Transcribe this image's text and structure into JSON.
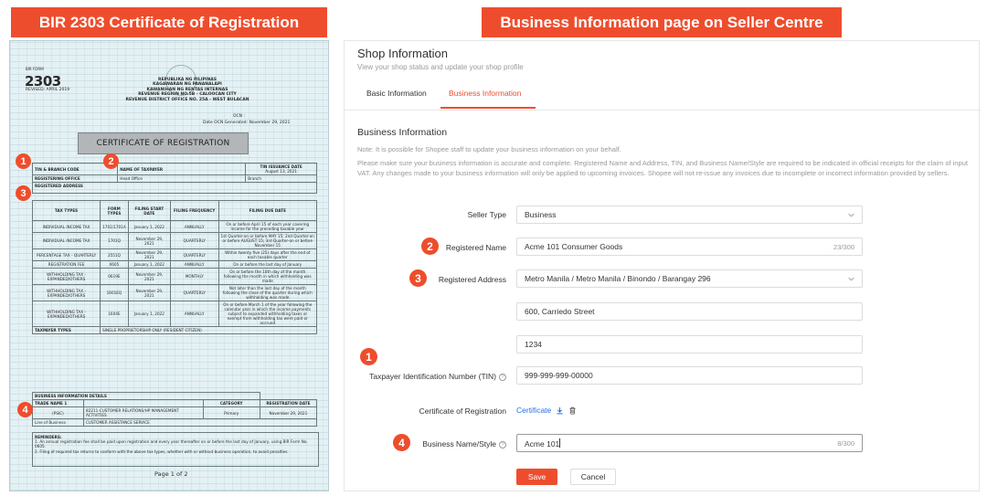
{
  "banners": {
    "left": "BIR 2303 Certificate of Registration",
    "right": "Business Information page on Seller Centre"
  },
  "certificate": {
    "form_label": "BIR FORM",
    "form_number": "2303",
    "revised": "REVISED: APRIL 2019",
    "agency_lines": [
      "REPUBLIKA NG PILIPINAS",
      "KAGAWARAN NG PANANALAPI",
      "KAWANIHAN NG RENTAS INTERNAS",
      "REVENUE REGION NO.5B - CALOOCAN CITY",
      "REVENUE DISTRICT OFFICE NO. 25A - WEST BULACAN"
    ],
    "ocn": "OCN :",
    "ocn_date": "Date OCN Generated: November 29, 2021",
    "title": "CERTIFICATE OF REGISTRATION",
    "header": {
      "tin_branch_code": "TIN & BRANCH CODE",
      "name_of_taxpayer": "NAME OF TAXPAYER",
      "tin_issuance_date": "TIN ISSUANCE DATE",
      "issuance_value": "August 13, 2021",
      "registering_office": "REGISTERING OFFICE",
      "head_office": "Head Office",
      "branch": "Branch",
      "registered_address": "REGISTERED ADDRESS"
    },
    "tax_columns": [
      "TAX TYPES",
      "FORM TYPES",
      "FILING START DATE",
      "FILING FREQUENCY",
      "FILING DUE DATE"
    ],
    "tax_rows": [
      [
        "INDIVIDUAL INCOME TAX",
        "1701/1701A",
        "January 1, 2022",
        "ANNUALLY",
        "On or before April 15 of each year covering income for the preceding taxable year"
      ],
      [
        "INDIVIDUAL INCOME TAX",
        "1701Q",
        "November 29, 2021",
        "QUARTERLY",
        "1st Quarter-on or before MAY 15; 2nd Quarter-on or before AUGUST 15; 3rd Quarter-on or before November 15"
      ],
      [
        "PERCENTAGE TAX - QUARTERLY",
        "2551Q",
        "November 29, 2021",
        "QUARTERLY",
        "Within twenty five (25) days after the end of each taxable quarter"
      ],
      [
        "REGISTRATION FEE",
        "0605",
        "January 1, 2022",
        "ANNUALLY",
        "On or before the last day of January"
      ],
      [
        "WITHHOLDING TAX - EXPANDED/OTHERS",
        "0619E",
        "November 29, 2021",
        "MONTHLY",
        "On or before the 10th day of the month following the month in which withholding was made"
      ],
      [
        "WITHHOLDING TAX - EXPANDED/OTHERS",
        "1601EQ",
        "November 29, 2021",
        "QUARTERLY",
        "Not later than the last day of the month following the close of the quarter during which withholding was made"
      ],
      [
        "WITHHOLDING TAX - EXPANDED/OTHERS",
        "1604E",
        "January 1, 2022",
        "ANNUALLY",
        "On or before March 1 of the year following the calendar year in which the income payments subject to expanded withholding taxes or exempt from withholding tax were paid or accrued"
      ]
    ],
    "taxpayer_types_label": "TAXPAYER TYPES",
    "taxpayer_types_value": "SINGLE PROPRIETORSHIP ONLY (RESIDENT CITIZEN)",
    "business_details_label": "BUSINESS INFORMATION DETAILS",
    "category_label": "CATEGORY",
    "registration_date_label": "REGISTRATION DATE",
    "trade_name_label": "TRADE NAME 1",
    "registration_date_value": "November 29, 2021",
    "psic_label": "(PSIC)",
    "psic_value": "82211-CUSTOMER RELATIONS/HP MANAGEMENT ACTIVITIES",
    "category_value": "Primary",
    "line_of_business_label": "Line of Business",
    "line_of_business_value": "CUSTOMER ASSISTANCE SERVICE",
    "reminders_title": "REMINDERS:",
    "reminders": [
      "1.  An annual registration fee shall be paid upon registration and every year thereafter on or before the last day of January, using BIR Form No. 0605.",
      "2.  Filing of required tax returns to conform with the above tax types, whether with or without business operation, to avoid penalties."
    ],
    "page": "Page 1 of 2",
    "badges": [
      "1",
      "2",
      "3",
      "4"
    ]
  },
  "seller_centre": {
    "title": "Shop Information",
    "subtitle": "View your shop status and update your shop profile",
    "tabs": [
      "Basic Information",
      "Business Information"
    ],
    "section_title": "Business Information",
    "note1": "Note: It is possible for Shopee staff to update your business information on your behalf.",
    "note2": "Please make sure your business information is accurate and complete. Registered Name and Address, TIN, and Business Name/Style are required to be indicated in official receipts for the claim of input VAT. Any changes made to your business information will only be applied to upcoming invoices. Shopee will not re-issue any invoices due to incomplete or incorrect information provided by sellers.",
    "seller_type_label": "Seller Type",
    "seller_type_value": "Business",
    "registered_name_label": "Registered Name",
    "registered_name_value": "Acme 101 Consumer Goods",
    "registered_name_count": "23/300",
    "registered_address_label": "Registered Address",
    "registered_address_value": "Metro Manila / Metro Manila / Binondo / Barangay 296",
    "street_value": "600, Carriedo Street",
    "zip_value": "1234",
    "tin_label": "Taxpayer Identification Number (TIN)",
    "tin_value": "999-999-999-00000",
    "certificate_label": "Certificate of Registration",
    "certificate_link": "Certificate",
    "business_name_label": "Business Name/Style",
    "business_name_value": "Acme 101",
    "business_name_count": "8/300",
    "save_label": "Save",
    "cancel_label": "Cancel",
    "badges": [
      "2",
      "3",
      "1",
      "4"
    ],
    "accent_color": "#ee4d2d"
  }
}
